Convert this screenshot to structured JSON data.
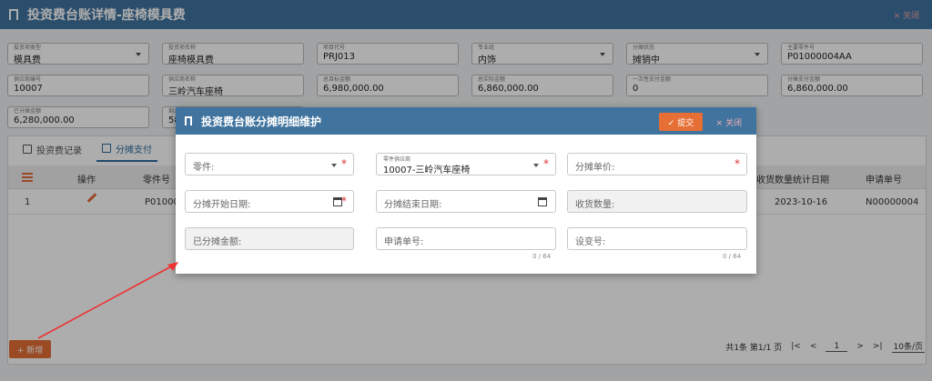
{
  "header": {
    "title": "投资费台账详情-座椅模具费",
    "close_label": "× 关闭"
  },
  "form": {
    "fields": [
      {
        "label": "投资项类型",
        "value": "模具费",
        "dropdown": true
      },
      {
        "label": "投资项名称",
        "value": "座椅模具费"
      },
      {
        "label": "项目代号",
        "value": "PRJ013"
      },
      {
        "label": "专业组",
        "value": "内饰",
        "dropdown": true
      },
      {
        "label": "分摊状态",
        "value": "摊销中",
        "dropdown": true
      },
      {
        "label": "主要零件号",
        "value": "P01000004AA"
      },
      {
        "label": "供应商编号",
        "value": "10007"
      },
      {
        "label": "供应商名称",
        "value": "三岭汽车座椅"
      },
      {
        "label": "总目标金额",
        "value": "6,980,000.00"
      },
      {
        "label": "总实际金额",
        "value": "6,860,000.00"
      },
      {
        "label": "一次性支付金额",
        "value": "0"
      },
      {
        "label": "分摊支付金额",
        "value": "6,860,000.00"
      },
      {
        "label": "已分摊金额",
        "value": "6,280,000.00"
      },
      {
        "label": "剩余分摊金额",
        "value": "58"
      }
    ]
  },
  "tabs": [
    {
      "label": "投资费记录"
    },
    {
      "label": "分摊支付"
    }
  ],
  "table": {
    "headers": [
      "操作",
      "零件号",
      "收货数量统计日期",
      "申请单号"
    ],
    "row": {
      "index": "1",
      "part": "P010000",
      "date": "2023-10-16",
      "apply_no": "N00000004"
    }
  },
  "add_button": "+ 新增",
  "pager": {
    "summary": "共1条 第1/1 页",
    "page": "1",
    "page_size": "10条/页",
    "first": "|<",
    "prev": "<",
    "next": ">",
    "last": ">|"
  },
  "modal": {
    "title": "投资费台账分摊明细维护",
    "submit": "✓ 提交",
    "close": "× 关闭",
    "fields": {
      "part": "零件:",
      "supplier_label": "零件供应商",
      "supplier_value": "10007-三岭汽车座椅",
      "unit_price": "分摊单价:",
      "start_date": "分摊开始日期:",
      "end_date": "分摊结束日期:",
      "received_qty": "收货数量:",
      "allocated_amount": "已分摊金额:",
      "apply_no": "申请单号:",
      "change_no": "设变号:",
      "counter1": "0 / 64",
      "counter2": "0 / 64"
    }
  },
  "colors": {
    "header": "#40749f",
    "accent": "#e56f35",
    "required": "#d33333"
  }
}
